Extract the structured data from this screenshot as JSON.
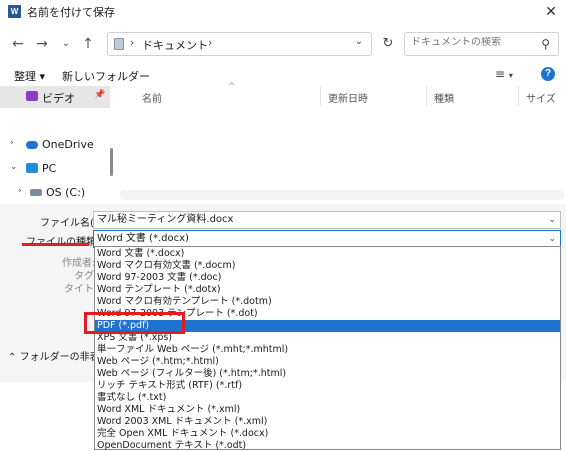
{
  "window": {
    "title": "名前を付けて保存",
    "app_icon": "W"
  },
  "address_bar": {
    "location": "ドキュメント"
  },
  "search": {
    "placeholder": "ドキュメントの検索"
  },
  "toolbar": {
    "organize": "整理 ▾",
    "new_folder": "新しいフォルダー"
  },
  "sidebar": {
    "items": [
      {
        "label": "ビデオ",
        "icon": "video-icon"
      },
      {
        "label": "OneDrive",
        "icon": "cloud-icon"
      },
      {
        "label": "PC",
        "icon": "pc-icon"
      },
      {
        "label": "OS (C:)",
        "icon": "drive-icon"
      }
    ]
  },
  "columns": [
    "名前",
    "更新日時",
    "種類",
    "サイズ"
  ],
  "form": {
    "filename_label": "ファイル名(N):",
    "filename_value": "マル秘ミーティング資料.docx",
    "filetype_label": "ファイルの種類(T):",
    "filetype_value": "Word 文書 (*.docx)",
    "authors_label": "作成者:",
    "tags_label": "タグ:",
    "title_label": "タイトル:",
    "hide_folders": "フォルダーの非表示"
  },
  "dropdown": {
    "selected_index": 6,
    "items": [
      "Word 文書 (*.docx)",
      "Word マクロ有効文書 (*.docm)",
      "Word 97-2003 文書 (*.doc)",
      "Word テンプレート (*.dotx)",
      "Word マクロ有効テンプレート (*.dotm)",
      "Word 97-2003 テンプレート (*.dot)",
      "PDF (*.pdf)",
      "XPS 文書 (*.xps)",
      "単一ファイル Web ページ (*.mht;*.mhtml)",
      "Web ページ (*.htm;*.html)",
      "Web ページ (フィルター後) (*.htm;*.html)",
      "リッチ テキスト形式 (RTF) (*.rtf)",
      "書式なし (*.txt)",
      "Word XML ドキュメント (*.xml)",
      "Word 2003 XML ドキュメント (*.xml)",
      "完全 Open XML ドキュメント (*.docx)",
      "OpenDocument テキスト (*.odt)"
    ]
  },
  "colors": {
    "accent": "#1e73d0",
    "highlight": "#e11d1d"
  }
}
